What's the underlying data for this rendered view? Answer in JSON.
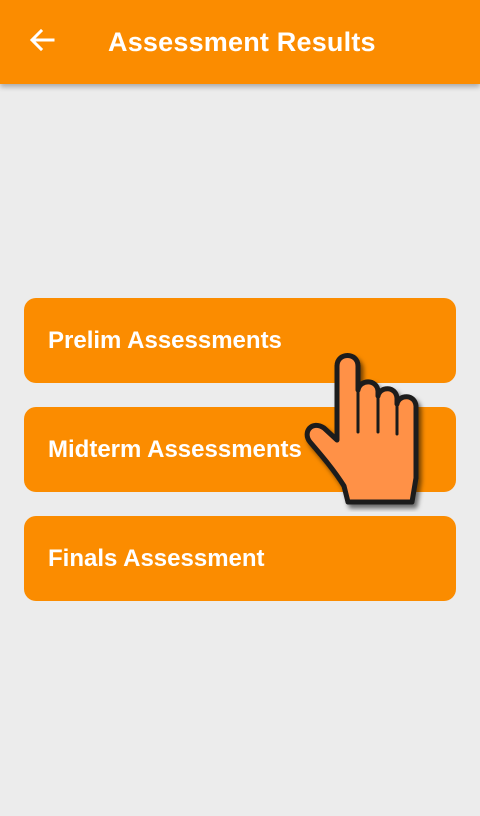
{
  "app_bar": {
    "title": "Assessment Results",
    "back_icon": "arrow-left-icon",
    "color": "#fb8c00"
  },
  "menu": {
    "items": [
      {
        "label": "Prelim Assessments"
      },
      {
        "label": "Midterm Assessments"
      },
      {
        "label": "Finals Assessment"
      }
    ]
  },
  "overlay": {
    "icon": "pointing-hand-icon",
    "color": "#ff9147"
  },
  "colors": {
    "accent": "#fb8c00",
    "background": "#ececec",
    "text_on_accent": "#ffffff"
  }
}
